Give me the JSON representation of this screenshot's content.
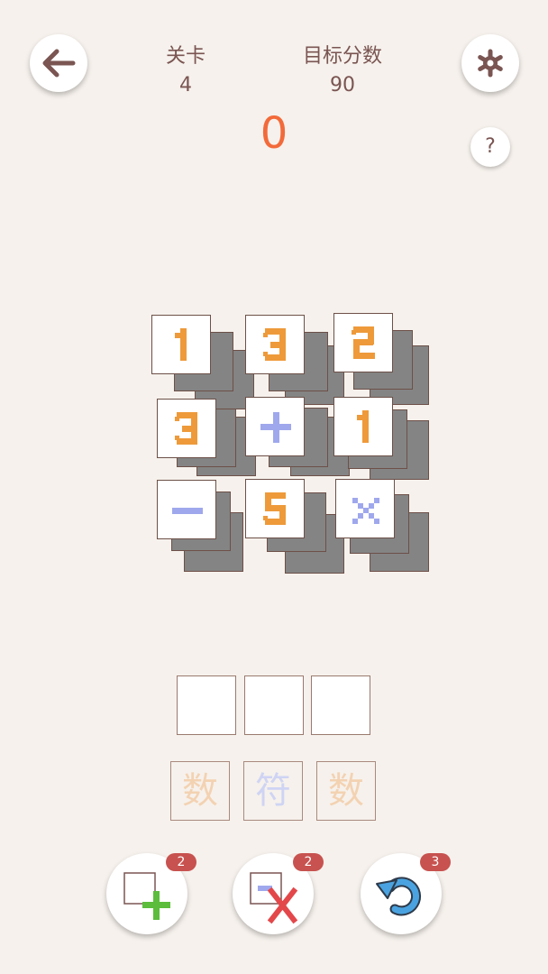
{
  "header": {
    "level_label": "关卡",
    "level_value": "4",
    "target_label": "目标分数",
    "target_value": "90"
  },
  "score": "0",
  "help_label": "?",
  "board": {
    "visible_tiles": [
      {
        "symbol": "1",
        "kind": "number"
      },
      {
        "symbol": "3",
        "kind": "number"
      },
      {
        "symbol": "2",
        "kind": "number"
      },
      {
        "symbol": "3",
        "kind": "number"
      },
      {
        "symbol": "+",
        "kind": "operator"
      },
      {
        "symbol": "1",
        "kind": "number"
      },
      {
        "symbol": "−",
        "kind": "operator"
      },
      {
        "symbol": "5",
        "kind": "number"
      },
      {
        "symbol": "×",
        "kind": "operator"
      }
    ]
  },
  "slot_hints": [
    "数",
    "符",
    "数"
  ],
  "powerups": [
    {
      "name": "add-tile",
      "count": "2"
    },
    {
      "name": "remove-tile",
      "count": "2"
    },
    {
      "name": "undo",
      "count": "3"
    }
  ],
  "colors": {
    "number": "#ee9a3a",
    "operator": "#9fa8ec",
    "background": "#f6f1ec",
    "score": "#f36a3a"
  }
}
